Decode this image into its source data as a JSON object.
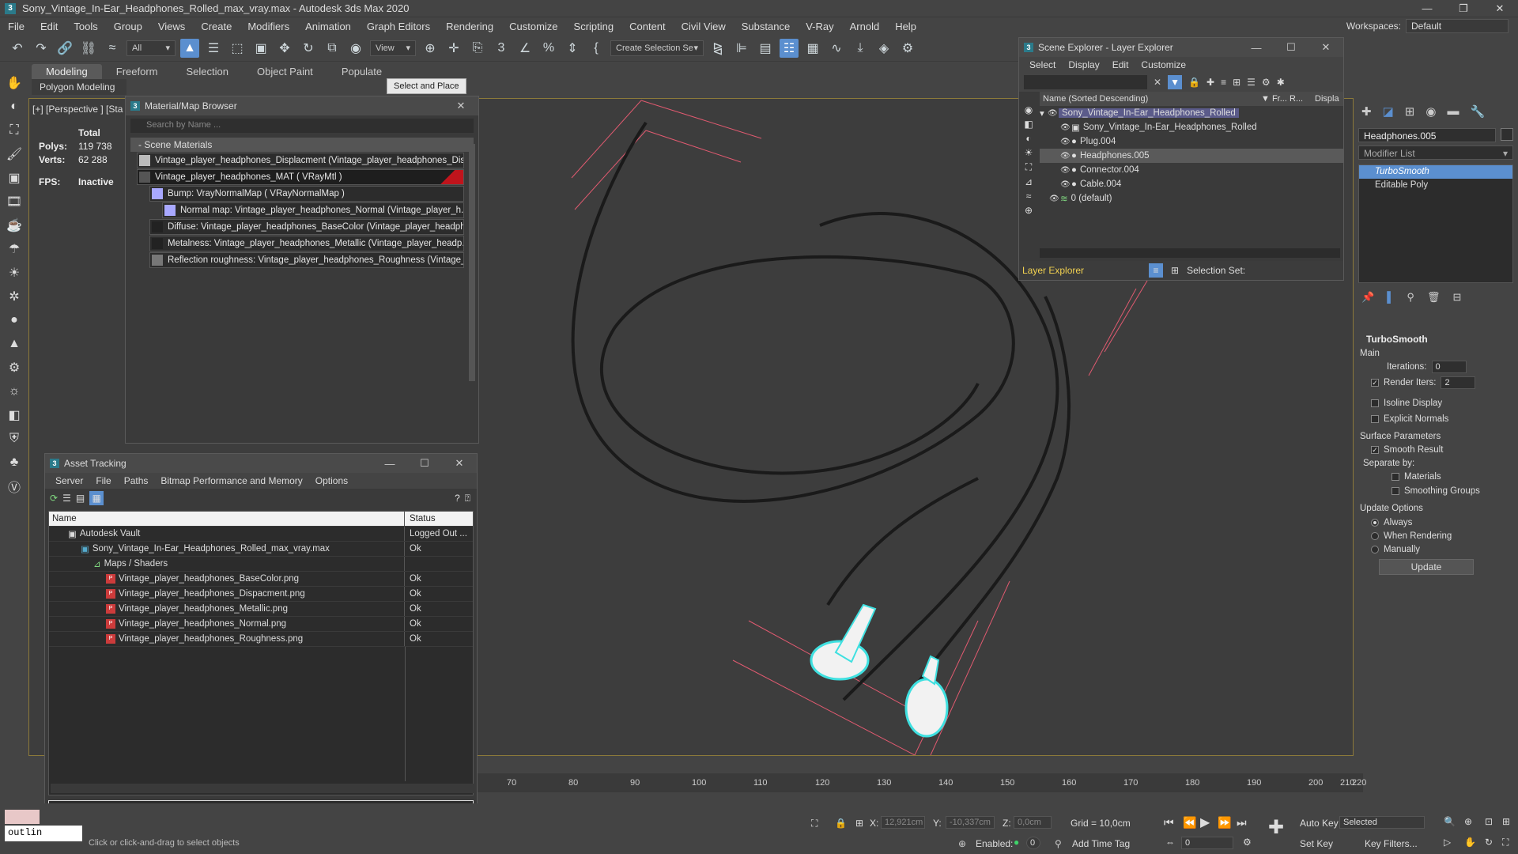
{
  "titlebar": {
    "title": "Sony_Vintage_In-Ear_Headphones_Rolled_max_vray.max - Autodesk 3ds Max 2020",
    "app_icon": "3"
  },
  "menubar": {
    "items": [
      "File",
      "Edit",
      "Tools",
      "Group",
      "Views",
      "Create",
      "Modifiers",
      "Animation",
      "Graph Editors",
      "Rendering",
      "Customize",
      "Scripting",
      "Content",
      "Civil View",
      "Substance",
      "V-Ray",
      "Arnold",
      "Help"
    ],
    "workspace_label": "Workspaces:",
    "workspace_value": "Default"
  },
  "toolbar": {
    "filter_value": "All",
    "view_value": "View",
    "selection_set_value": "Create Selection Se"
  },
  "ribbon": {
    "tabs": [
      "Modeling",
      "Freeform",
      "Selection",
      "Object Paint",
      "Populate"
    ],
    "sub_label": "Polygon Modeling",
    "tooltip": "Select and Place"
  },
  "viewport": {
    "label": "[+] [Perspective ] [Sta",
    "stats": {
      "total_label": "Total",
      "polys_label": "Polys:",
      "polys_value": "119 738",
      "verts_label": "Verts:",
      "verts_value": "62 288",
      "fps_label": "FPS:",
      "fps_value": "Inactive"
    }
  },
  "material_browser": {
    "title": "Material/Map Browser",
    "search_placeholder": "Search by Name ...",
    "section": "- Scene Materials",
    "rows": [
      "Vintage_player_headphones_Displacment (Vintage_player_headphones_Dis...",
      "Vintage_player_headphones_MAT ( VRayMtl )",
      "Bump: VrayNormalMap ( VRayNormalMap )",
      "Normal map: Vintage_player_headphones_Normal (Vintage_player_h...",
      "Diffuse: Vintage_player_headphones_BaseColor (Vintage_player_headph...",
      "Metalness: Vintage_player_headphones_Metallic (Vintage_player_headp...",
      "Reflection roughness: Vintage_player_headphones_Roughness (Vintage_..."
    ]
  },
  "scene_explorer": {
    "title": "Scene Explorer - Layer Explorer",
    "menu": [
      "Select",
      "Display",
      "Edit",
      "Customize"
    ],
    "col_name": "Name (Sorted Descending)",
    "col_fr": "▼ Fr...",
    "col_r": "R...",
    "col_disp": "Displa",
    "rows": [
      "Sony_Vintage_In-Ear_Headphones_Rolled",
      "Sony_Vintage_In-Ear_Headphones_Rolled",
      "Plug.004",
      "Headphones.005",
      "Connector.004",
      "Cable.004",
      "0 (default)"
    ],
    "layer_dropdown": "Layer Explorer",
    "selection_set_label": "Selection Set:"
  },
  "asset_tracking": {
    "title": "Asset Tracking",
    "menu": [
      "Server",
      "File",
      "Paths",
      "Bitmap Performance and Memory",
      "Options"
    ],
    "col_name": "Name",
    "col_status": "Status",
    "rows": [
      {
        "name": "Autodesk Vault",
        "status": "Logged Out ..."
      },
      {
        "name": "Sony_Vintage_In-Ear_Headphones_Rolled_max_vray.max",
        "status": "Ok"
      },
      {
        "name": "Maps / Shaders",
        "status": ""
      },
      {
        "name": "Vintage_player_headphones_BaseColor.png",
        "status": "Ok"
      },
      {
        "name": "Vintage_player_headphones_Dispacment.png",
        "status": "Ok"
      },
      {
        "name": "Vintage_player_headphones_Metallic.png",
        "status": "Ok"
      },
      {
        "name": "Vintage_player_headphones_Normal.png",
        "status": "Ok"
      },
      {
        "name": "Vintage_player_headphones_Roughness.png",
        "status": "Ok"
      }
    ]
  },
  "command_panel": {
    "object_name": "Headphones.005",
    "modifier_list": "Modifier List",
    "stack": [
      "TurboSmooth",
      "Editable Poly"
    ],
    "rollout_title": "TurboSmooth",
    "main_label": "Main",
    "iterations_label": "Iterations:",
    "iterations_value": "0",
    "render_iters_label": "Render Iters:",
    "render_iters_value": "2",
    "isoline_label": "Isoline Display",
    "explicit_normals_label": "Explicit Normals",
    "surface_params_label": "Surface Parameters",
    "smooth_result_label": "Smooth Result",
    "separate_by_label": "Separate by:",
    "materials_label": "Materials",
    "smoothing_groups_label": "Smoothing Groups",
    "update_options_label": "Update Options",
    "always_label": "Always",
    "when_rendering_label": "When Rendering",
    "manually_label": "Manually",
    "update_button": "Update"
  },
  "timeline": {
    "ticks": [
      "70",
      "80",
      "90",
      "100",
      "110",
      "120",
      "130",
      "140",
      "150",
      "160",
      "170",
      "180",
      "190",
      "200",
      "210",
      "220"
    ]
  },
  "statusbar": {
    "maxscript": "outlin",
    "prompt": "Click or click-and-drag to select objects",
    "x_label": "X:",
    "x_value": "12,921cm",
    "y_label": "Y:",
    "y_value": "-10,337cm",
    "z_label": "Z:",
    "z_value": "0,0cm",
    "grid": "Grid = 10,0cm",
    "enabled_label": "Enabled:",
    "enabled_value": "0",
    "add_time_tag": "Add Time Tag",
    "auto_key": "Auto Key",
    "set_key": "Set Key",
    "selected_value": "Selected",
    "frame_value": "0",
    "key_filters": "Key Filters..."
  }
}
